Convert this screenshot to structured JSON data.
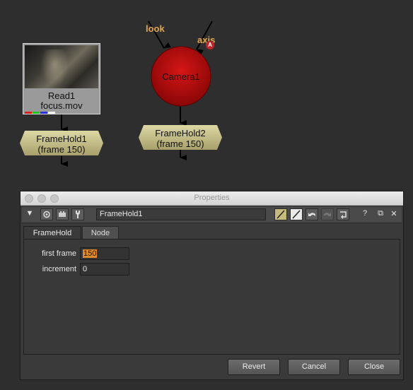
{
  "node_graph": {
    "read_node": {
      "name": "Read1",
      "file": "focus.mov"
    },
    "framehold1": {
      "name": "FrameHold1",
      "frame_label": "(frame 150)"
    },
    "camera_node": {
      "name": "Camera1",
      "input_look": "look",
      "input_axis": "axis",
      "axis_badge": "A"
    },
    "framehold2": {
      "name": "FrameHold2",
      "frame_label": "(frame 150)"
    }
  },
  "properties": {
    "window_title": "Properties",
    "node_name": "FrameHold1",
    "toolbar": {
      "collapse_glyph": "▼",
      "help_glyph": "?",
      "float_glyph": "⧉",
      "close_glyph": "✕"
    },
    "tabs": [
      {
        "label": "FrameHold"
      },
      {
        "label": "Node"
      }
    ],
    "fields": {
      "first_frame": {
        "label": "first frame",
        "value": "150"
      },
      "increment": {
        "label": "increment",
        "value": "0"
      }
    },
    "buttons": {
      "revert": "Revert",
      "cancel": "Cancel",
      "close": "Close"
    }
  },
  "colors": {
    "accent_orange": "#e28a25",
    "camera_red": "#cc1010",
    "framehold_tan": "#c9c28a",
    "input_label": "#e0a64a"
  }
}
